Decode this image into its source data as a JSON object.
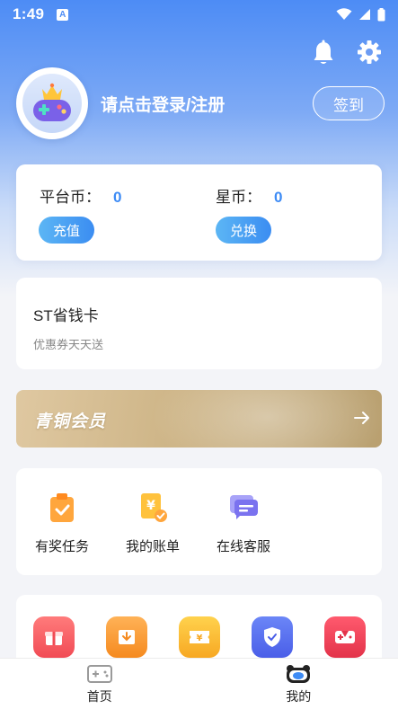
{
  "status_bar": {
    "time": "1:49",
    "app_badge": "A"
  },
  "profile": {
    "login_text": "请点击登录/注册",
    "checkin_label": "签到"
  },
  "wallet": {
    "platform_coin_label": "平台币：",
    "platform_coin_value": "0",
    "star_coin_label": "星币：",
    "star_coin_value": "0",
    "recharge_label": "充值",
    "exchange_label": "兑换"
  },
  "saver_card": {
    "title": "ST省钱卡",
    "subtitle": "优惠券天天送"
  },
  "membership": {
    "title": "青铜会员"
  },
  "services": [
    {
      "label": "有奖任务",
      "icon": "task-clipboard-icon"
    },
    {
      "label": "我的账单",
      "icon": "bill-icon"
    },
    {
      "label": "在线客服",
      "icon": "customer-service-icon"
    }
  ],
  "tools": [
    {
      "icon": "gift-icon"
    },
    {
      "icon": "download-box-icon"
    },
    {
      "icon": "coupon-icon"
    },
    {
      "icon": "shield-icon"
    },
    {
      "icon": "gamepad-icon"
    }
  ],
  "bottom_nav": {
    "home_label": "首页",
    "mine_label": "我的"
  },
  "colors": {
    "accent": "#3d8bf5",
    "gold": "#cdb486",
    "hero": "#4d8cf5"
  }
}
